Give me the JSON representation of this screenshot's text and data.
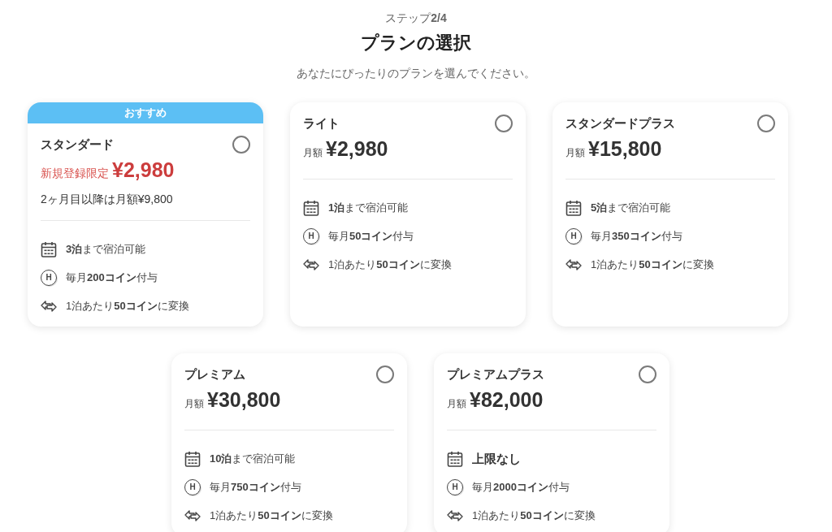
{
  "header": {
    "step": "ステップ**2/4**",
    "title": "プランの選択",
    "subtitle": "あなたにぴったりのプランを選んでください。"
  },
  "plans": [
    {
      "badge": "おすすめ",
      "name": "スタンダード",
      "selected": false,
      "price": {
        "kind": "promo",
        "label": "新規登録限定",
        "amount": "¥2,980",
        "note": "2ヶ月目以降は月額¥9,800"
      },
      "features": [
        {
          "kind": "nights",
          "emphasized": false,
          "text": "**3泊**まで宿泊可能"
        },
        {
          "kind": "coins",
          "symbol": "H",
          "emphasized": false,
          "text": "毎月**200コイン**付与"
        },
        {
          "kind": "exchange",
          "emphasized": false,
          "text": "1泊あたり**50コイン**に変換"
        }
      ]
    },
    {
      "name": "ライト",
      "selected": false,
      "price": {
        "kind": "monthly",
        "label": "月額",
        "amount": "¥2,980"
      },
      "features": [
        {
          "kind": "nights",
          "emphasized": false,
          "text": "**1泊**まで宿泊可能"
        },
        {
          "kind": "coins",
          "symbol": "H",
          "emphasized": false,
          "text": "毎月**50コイン**付与"
        },
        {
          "kind": "exchange",
          "emphasized": false,
          "text": "1泊あたり**50コイン**に変換"
        }
      ]
    },
    {
      "name": "スタンダードプラス",
      "selected": false,
      "price": {
        "kind": "monthly",
        "label": "月額",
        "amount": "¥15,800"
      },
      "features": [
        {
          "kind": "nights",
          "emphasized": false,
          "text": "**5泊**まで宿泊可能"
        },
        {
          "kind": "coins",
          "symbol": "H",
          "emphasized": false,
          "text": "毎月**350コイン**付与"
        },
        {
          "kind": "exchange",
          "emphasized": false,
          "text": "1泊あたり**50コイン**に変換"
        }
      ]
    },
    {
      "name": "プレミアム",
      "selected": false,
      "price": {
        "kind": "monthly",
        "label": "月額",
        "amount": "¥30,800"
      },
      "features": [
        {
          "kind": "nights",
          "emphasized": false,
          "text": "**10泊**まで宿泊可能"
        },
        {
          "kind": "coins",
          "symbol": "H",
          "emphasized": false,
          "text": "毎月**750コイン**付与"
        },
        {
          "kind": "exchange",
          "emphasized": false,
          "text": "1泊あたり**50コイン**に変換"
        }
      ]
    },
    {
      "name": "プレミアムプラス",
      "selected": false,
      "price": {
        "kind": "monthly",
        "label": "月額",
        "amount": "¥82,000"
      },
      "features": [
        {
          "kind": "nights",
          "emphasized": true,
          "text": "上限なし"
        },
        {
          "kind": "coins",
          "symbol": "H",
          "emphasized": false,
          "text": "毎月**2000コイン**付与"
        },
        {
          "kind": "exchange",
          "emphasized": false,
          "text": "1泊あたり**50コイン**に変換"
        }
      ]
    }
  ]
}
